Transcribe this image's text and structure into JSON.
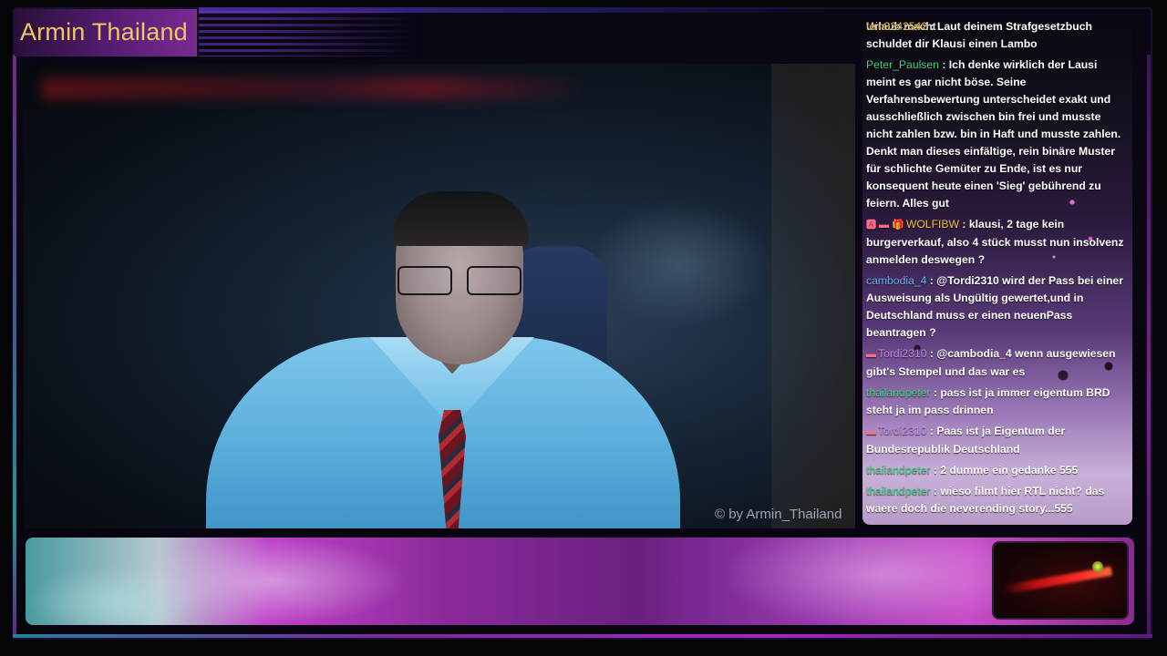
{
  "stream": {
    "title": "Armin Thailand",
    "watermark": "© by Armin_Thailand"
  },
  "chat": {
    "cut_off_text": "Urlaub macht",
    "messages": [
      {
        "user": "tein3242542",
        "user_color": "#f0c040",
        "badges": "",
        "text": " : Laut deinem Strafgesetzbuch schuldet dir Klausi einen Lambo"
      },
      {
        "user": "Peter_Paulsen",
        "user_color": "#40d080",
        "badges": "",
        "text": " : Ich denke wirklich der Lausi meint es gar nicht böse. Seine Verfahrensbewertung unterscheidet exakt und ausschließlich zwischen bin frei und musste nicht zahlen bzw. bin in Haft und musste zahlen. Denkt man dieses einfältige, rein binäre Muster für schlichte Gemüter zu Ende, ist es nur konsequent heute einen 'Sieg' gebührend zu feiern. Alles gut"
      },
      {
        "user": "WOLFIBW",
        "user_color": "#f0c040",
        "badges": "🅰 ▬ 🎁",
        "text": " : klausi, 2 tage kein burgerverkauf, also 4 stück musst nun insolvenz anmelden deswegen ?"
      },
      {
        "user": "cambodia_4",
        "user_color": "#6aaef0",
        "badges": "",
        "text": " : @Tordi2310 wird der Pass bei einer Ausweisung als Ungültig gewertet,und in Deutschland muss er einen neuenPass beantragen ?"
      },
      {
        "user": "Tordi2310",
        "user_color": "#c08ae8",
        "badges": "▬",
        "text": " : @cambodia_4 wenn ausgewiesen gibt's Stempel und das war es"
      },
      {
        "user": "thailandpeter",
        "user_color": "#40d080",
        "badges": "",
        "text": " : pass ist ja immer eigentum BRD steht ja im pass drinnen"
      },
      {
        "user": "Tordi2310",
        "user_color": "#c08ae8",
        "badges": "▬",
        "text": " : Paas ist ja Eigentum der Bundesrepublik Deutschland"
      },
      {
        "user": "thailandpeter",
        "user_color": "#40d080",
        "badges": "",
        "text": " : 2 dumme ein gedanke 555"
      },
      {
        "user": "thailandpeter",
        "user_color": "#40d080",
        "badges": "",
        "text": " : wieso filmt hier RTL nicht? das waere doch die neverending story...555"
      }
    ]
  }
}
